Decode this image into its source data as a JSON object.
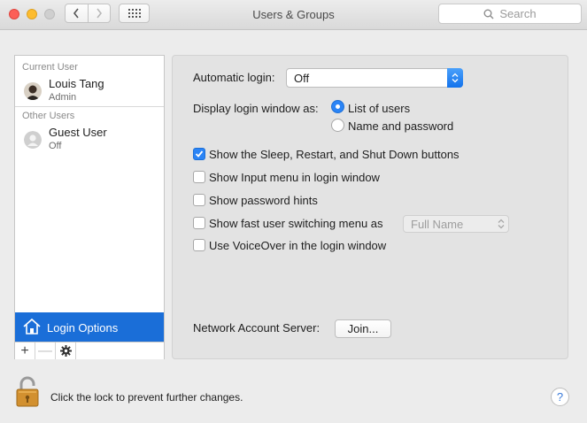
{
  "window": {
    "title": "Users & Groups"
  },
  "toolbar": {
    "search_placeholder": "Search"
  },
  "sidebar": {
    "current_user_header": "Current User",
    "other_users_header": "Other Users",
    "users": [
      {
        "name": "Louis Tang",
        "role": "Admin"
      },
      {
        "name": "Guest User",
        "role": "Off"
      }
    ],
    "login_options_label": "Login Options",
    "add_label": "+",
    "remove_label": "—"
  },
  "panel": {
    "automatic_login_label": "Automatic login:",
    "automatic_login_value": "Off",
    "display_window_label": "Display login window as:",
    "display_options": [
      {
        "label": "List of users",
        "selected": true
      },
      {
        "label": "Name and password",
        "selected": false
      }
    ],
    "checkboxes": [
      {
        "label": "Show the Sleep, Restart, and Shut Down buttons",
        "checked": true
      },
      {
        "label": "Show Input menu in login window",
        "checked": false
      },
      {
        "label": "Show password hints",
        "checked": false
      },
      {
        "label": "Show fast user switching menu as",
        "checked": false
      },
      {
        "label": "Use VoiceOver in the login window",
        "checked": false
      }
    ],
    "fast_switch_value": "Full Name",
    "network_label": "Network Account Server:",
    "join_label": "Join..."
  },
  "footer": {
    "lock_text": "Click the lock to prevent further changes.",
    "help_label": "?"
  },
  "colors": {
    "accent": "#1a6ed8",
    "checkbox_on": "#2a84f6"
  }
}
